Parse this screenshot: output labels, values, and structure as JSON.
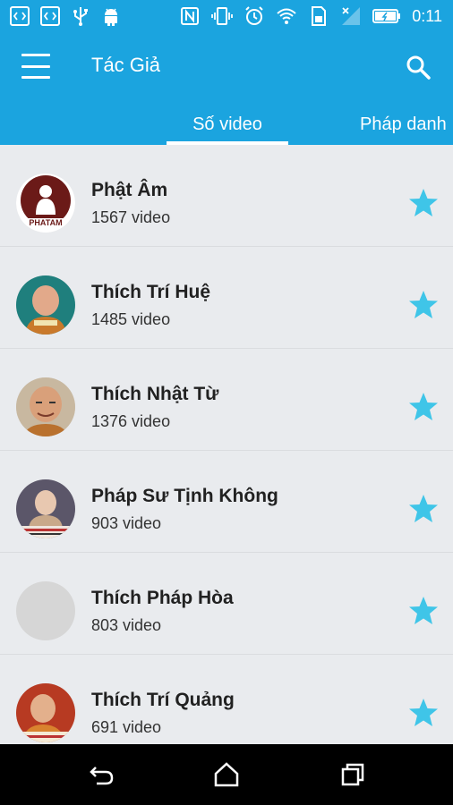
{
  "status_bar": {
    "time": "0:11",
    "left_icons": [
      "code-icon",
      "code-icon",
      "usb-icon",
      "android-icon"
    ],
    "right_icons": [
      "nfc-icon",
      "vibrate-icon",
      "alarm-icon",
      "wifi-icon",
      "sim-icon",
      "signal-icon",
      "battery-icon"
    ]
  },
  "app_bar": {
    "title": "Tác Giả",
    "menu_icon": "menu-icon",
    "search_icon": "search-icon",
    "accent_color": "#1ba4df"
  },
  "tabs": [
    {
      "label": "Số video",
      "active": true
    },
    {
      "label": "Pháp danh",
      "active": false
    }
  ],
  "authors": [
    {
      "name": "Phật Âm",
      "count": "1567 video",
      "avatar": "phatam-logo"
    },
    {
      "name": "Thích Trí Huệ",
      "count": "1485 video",
      "avatar": "monk-photo"
    },
    {
      "name": "Thích Nhật Từ",
      "count": "1376 video",
      "avatar": "monk-photo"
    },
    {
      "name": "Pháp Sư Tịnh Không",
      "count": "903 video",
      "avatar": "monk-photo"
    },
    {
      "name": "Thích Pháp Hòa",
      "count": "803 video",
      "avatar": "placeholder"
    },
    {
      "name": "Thích Trí Quảng",
      "count": "691 video",
      "avatar": "monk-photo"
    }
  ],
  "star_color": "#3fc5e8",
  "nav_bar": {
    "buttons": [
      "back-icon",
      "home-icon",
      "recents-icon"
    ]
  }
}
